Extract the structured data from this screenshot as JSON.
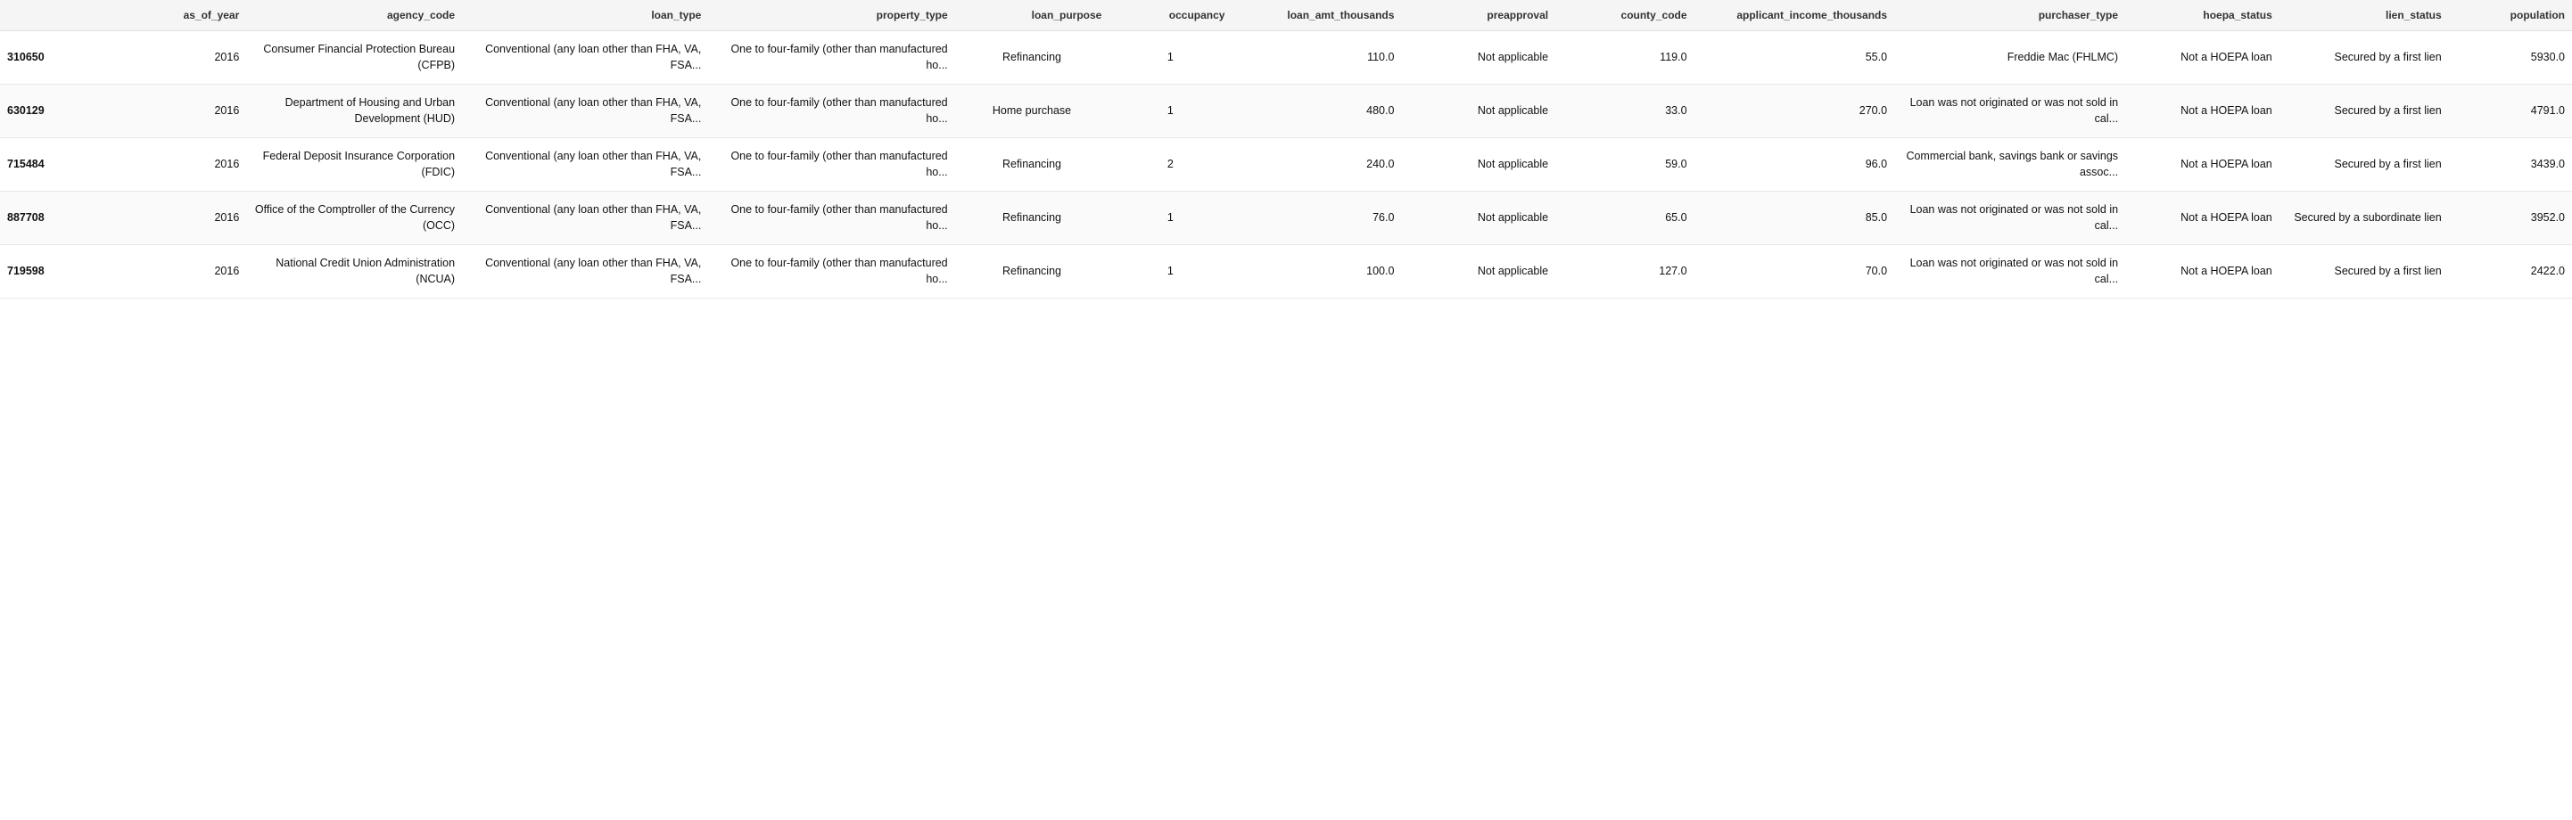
{
  "table": {
    "columns": [
      {
        "key": "id",
        "label": "",
        "align": "left"
      },
      {
        "key": "as_of_year",
        "label": "as_of_year",
        "align": "right"
      },
      {
        "key": "agency_code",
        "label": "agency_code",
        "align": "right"
      },
      {
        "key": "loan_type",
        "label": "loan_type",
        "align": "right"
      },
      {
        "key": "property_type",
        "label": "property_type",
        "align": "right"
      },
      {
        "key": "loan_purpose",
        "label": "loan_purpose",
        "align": "center"
      },
      {
        "key": "occupancy",
        "label": "occupancy",
        "align": "center"
      },
      {
        "key": "loan_amt_thousands",
        "label": "loan_amt_thousands",
        "align": "right"
      },
      {
        "key": "preapproval",
        "label": "preapproval",
        "align": "right"
      },
      {
        "key": "county_code",
        "label": "county_code",
        "align": "right"
      },
      {
        "key": "applicant_income_thousands",
        "label": "applicant_income_thousands",
        "align": "right"
      },
      {
        "key": "purchaser_type",
        "label": "purchaser_type",
        "align": "right"
      },
      {
        "key": "hoepa_status",
        "label": "hoepa_status",
        "align": "right"
      },
      {
        "key": "lien_status",
        "label": "lien_status",
        "align": "right"
      },
      {
        "key": "population",
        "label": "population",
        "align": "right"
      }
    ],
    "rows": [
      {
        "id": "310650",
        "as_of_year": "2016",
        "agency_code": "Consumer Financial Protection Bureau (CFPB)",
        "loan_type": "Conventional (any loan other than FHA, VA, FSA...",
        "property_type": "One to four-family (other than manufactured ho...",
        "loan_purpose": "Refinancing",
        "occupancy": "1",
        "loan_amt_thousands": "110.0",
        "preapproval": "Not applicable",
        "county_code": "119.0",
        "applicant_income_thousands": "55.0",
        "purchaser_type": "Freddie Mac (FHLMC)",
        "hoepa_status": "Not a HOEPA loan",
        "lien_status": "Secured by a first lien",
        "population": "5930.0"
      },
      {
        "id": "630129",
        "as_of_year": "2016",
        "agency_code": "Department of Housing and Urban Development (HUD)",
        "loan_type": "Conventional (any loan other than FHA, VA, FSA...",
        "property_type": "One to four-family (other than manufactured ho...",
        "loan_purpose": "Home purchase",
        "occupancy": "1",
        "loan_amt_thousands": "480.0",
        "preapproval": "Not applicable",
        "county_code": "33.0",
        "applicant_income_thousands": "270.0",
        "purchaser_type": "Loan was not originated or was not sold in cal...",
        "hoepa_status": "Not a HOEPA loan",
        "lien_status": "Secured by a first lien",
        "population": "4791.0"
      },
      {
        "id": "715484",
        "as_of_year": "2016",
        "agency_code": "Federal Deposit Insurance Corporation (FDIC)",
        "loan_type": "Conventional (any loan other than FHA, VA, FSA...",
        "property_type": "One to four-family (other than manufactured ho...",
        "loan_purpose": "Refinancing",
        "occupancy": "2",
        "loan_amt_thousands": "240.0",
        "preapproval": "Not applicable",
        "county_code": "59.0",
        "applicant_income_thousands": "96.0",
        "purchaser_type": "Commercial bank, savings bank or savings assoc...",
        "hoepa_status": "Not a HOEPA loan",
        "lien_status": "Secured by a first lien",
        "population": "3439.0"
      },
      {
        "id": "887708",
        "as_of_year": "2016",
        "agency_code": "Office of the Comptroller of the Currency (OCC)",
        "loan_type": "Conventional (any loan other than FHA, VA, FSA...",
        "property_type": "One to four-family (other than manufactured ho...",
        "loan_purpose": "Refinancing",
        "occupancy": "1",
        "loan_amt_thousands": "76.0",
        "preapproval": "Not applicable",
        "county_code": "65.0",
        "applicant_income_thousands": "85.0",
        "purchaser_type": "Loan was not originated or was not sold in cal...",
        "hoepa_status": "Not a HOEPA loan",
        "lien_status": "Secured by a subordinate lien",
        "population": "3952.0"
      },
      {
        "id": "719598",
        "as_of_year": "2016",
        "agency_code": "National Credit Union Administration (NCUA)",
        "loan_type": "Conventional (any loan other than FHA, VA, FSA...",
        "property_type": "One to four-family (other than manufactured ho...",
        "loan_purpose": "Refinancing",
        "occupancy": "1",
        "loan_amt_thousands": "100.0",
        "preapproval": "Not applicable",
        "county_code": "127.0",
        "applicant_income_thousands": "70.0",
        "purchaser_type": "Loan was not originated or was not sold in cal...",
        "hoepa_status": "Not a HOEPA loan",
        "lien_status": "Secured by a first lien",
        "population": "2422.0"
      }
    ]
  }
}
